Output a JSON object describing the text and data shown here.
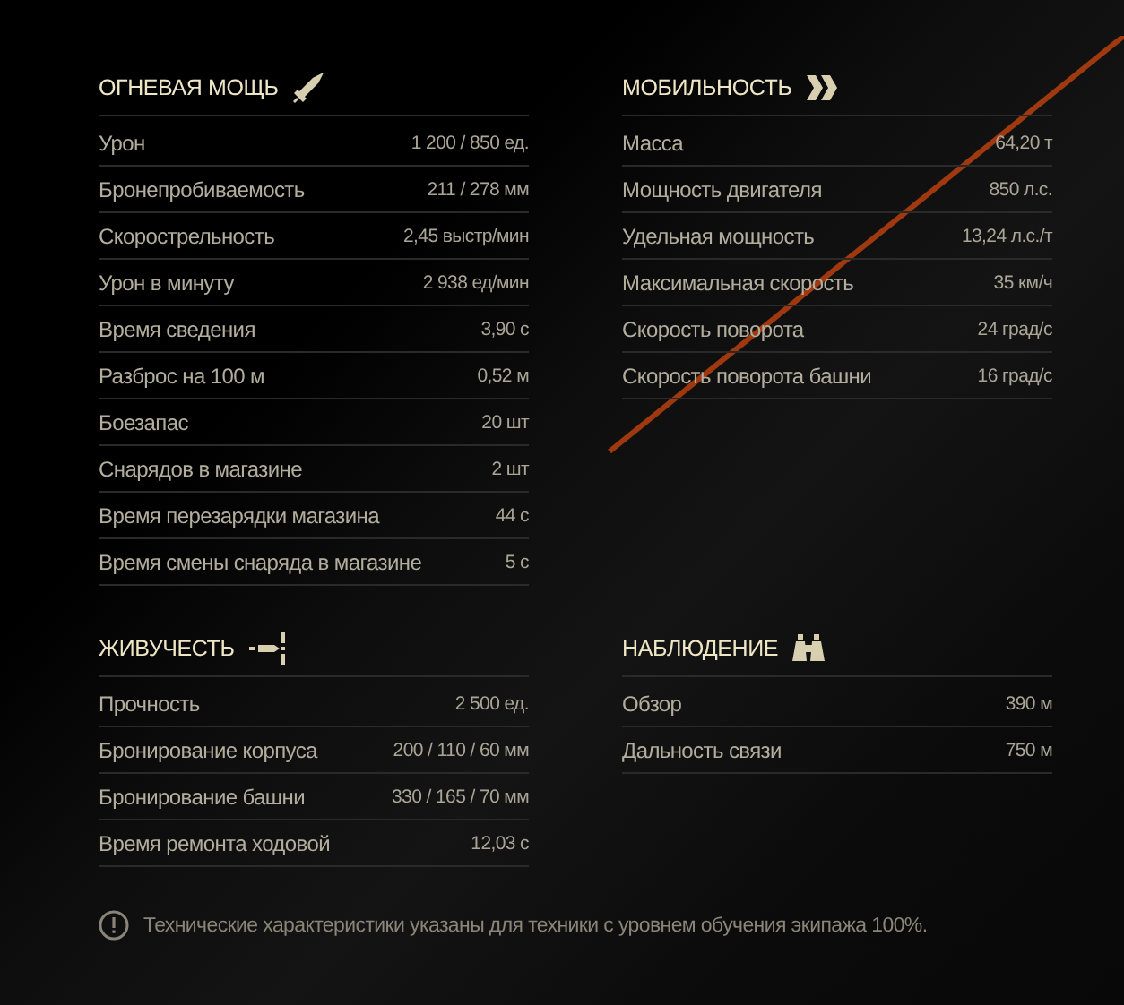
{
  "sections": [
    {
      "title": "ОГНЕВАЯ МОЩЬ",
      "kind": "sword",
      "rows": [
        {
          "label": "Урон",
          "value": "1 200 / 850 ед."
        },
        {
          "label": "Бронепробиваемость",
          "value": "211 / 278 мм"
        },
        {
          "label": "Скорострельность",
          "value": "2,45 выстр/мин"
        },
        {
          "label": "Урон в минуту",
          "value": "2 938 ед/мин"
        },
        {
          "label": "Время сведения",
          "value": "3,90 с"
        },
        {
          "label": "Разброс на 100 м",
          "value": "0,52 м"
        },
        {
          "label": "Боезапас",
          "value": "20 шт"
        },
        {
          "label": "Снарядов в магазине",
          "value": "2 шт"
        },
        {
          "label": "Время перезарядки магазина",
          "value": "44 с"
        },
        {
          "label": "Время смены снаряда в магазине",
          "value": "5 с"
        }
      ]
    },
    {
      "title": "МОБИЛЬНОСТЬ",
      "kind": "chevrons",
      "rows": [
        {
          "label": "Масса",
          "value": "64,20 т"
        },
        {
          "label": "Мощность двигателя",
          "value": "850 л.с."
        },
        {
          "label": "Удельная мощность",
          "value": "13,24 л.с./т"
        },
        {
          "label": "Максимальная скорость",
          "value": "35 км/ч"
        },
        {
          "label": "Скорость поворота",
          "value": "24 град/с"
        },
        {
          "label": "Скорость поворота башни",
          "value": "16 град/с"
        }
      ]
    },
    {
      "title": "ЖИВУЧЕСТЬ",
      "kind": "shell",
      "rows": [
        {
          "label": "Прочность",
          "value": "2 500 ед."
        },
        {
          "label": "Бронирование корпуса",
          "value": "200 / 110 / 60 мм"
        },
        {
          "label": "Бронирование башни",
          "value": "330 / 165 / 70 мм"
        },
        {
          "label": "Время ремонта ходовой",
          "value": "12,03 с"
        }
      ]
    },
    {
      "title": "НАБЛЮДЕНИЕ",
      "kind": "binoculars",
      "rows": [
        {
          "label": "Обзор",
          "value": "390 м"
        },
        {
          "label": "Дальность связи",
          "value": "750 м"
        }
      ]
    }
  ],
  "note": "Технические характеристики указаны для техники с уровнем обучения экипажа 100%."
}
